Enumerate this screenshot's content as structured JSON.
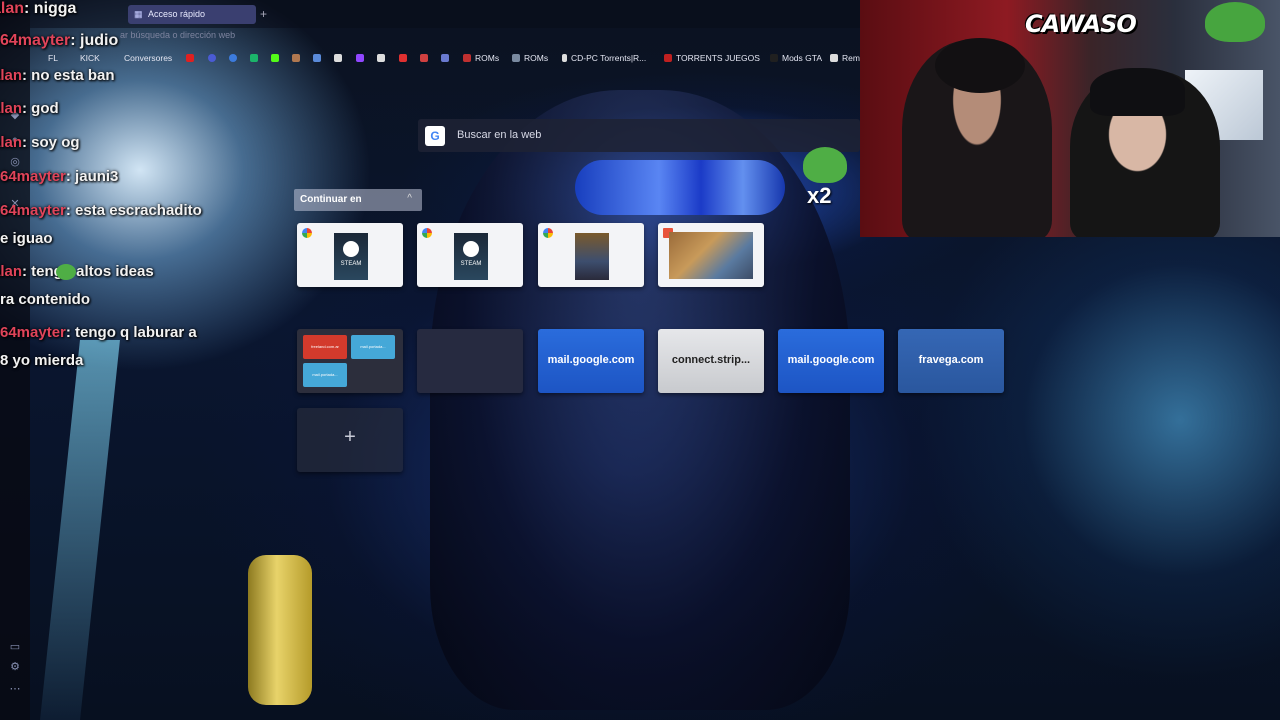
{
  "browser": {
    "tab_title": "Acceso rápido",
    "new_tab_symbol": "+",
    "address_placeholder": "ar búsqueda o dirección web",
    "bookmarks": [
      {
        "label": "FL",
        "color": "#c9c9c9"
      },
      {
        "label": "KICK",
        "color": "#c9c9c9"
      },
      {
        "label": "Conversores",
        "color": "#c9c9c9"
      },
      {
        "label": "",
        "color": "#e02020"
      },
      {
        "label": "",
        "color": "#4a5bd4"
      },
      {
        "label": "",
        "color": "#3c7bdd"
      },
      {
        "label": "",
        "color": "#1bb46a"
      },
      {
        "label": "",
        "color": "#53fc18"
      },
      {
        "label": "",
        "color": "#b07850"
      },
      {
        "label": "",
        "color": "#5a8ad9"
      },
      {
        "label": "",
        "color": "#dddddd"
      },
      {
        "label": "",
        "color": "#9147ff"
      },
      {
        "label": "",
        "color": "#dddddd"
      },
      {
        "label": "",
        "color": "#e03030"
      },
      {
        "label": "",
        "color": "#d04040"
      },
      {
        "label": "",
        "color": "#6a7ad0"
      },
      {
        "label": "ROMs",
        "color": "#c03030"
      },
      {
        "label": "ROMs",
        "color": "#7a8aa0"
      },
      {
        "label": "CD-PC Torrents|R...",
        "color": "#dddddd"
      },
      {
        "label": "TORRENTS JUEGOS",
        "color": "#c02020"
      },
      {
        "label": "Mods GTA",
        "color": "#202020"
      },
      {
        "label": "Rem",
        "color": "#dddddd"
      }
    ]
  },
  "chat": [
    {
      "user": "alan",
      "message": ": nigga"
    },
    {
      "user": "64mayter",
      "message": ": judio"
    },
    {
      "user": "alan",
      "message": ": no esta ban"
    },
    {
      "user": "alan",
      "message": ": god"
    },
    {
      "user": "alan",
      "message": ": soy og"
    },
    {
      "user": "64mayter",
      "message": ": jauni3"
    },
    {
      "user": "64mayter",
      "message": ": esta escrachadito"
    },
    {
      "user": "",
      "message": "e iguao"
    },
    {
      "user": "alan",
      "message": ":     tengo altos ideas"
    },
    {
      "user": "",
      "message": "ra contenido"
    },
    {
      "user": "64mayter",
      "message": ": tengo q laburar a"
    },
    {
      "user": "",
      "message": " 8 yo mierda"
    }
  ],
  "speed_dial": {
    "search_placeholder": "Buscar en la web",
    "search_engine_icon": "G",
    "continue_label": "Continuar en",
    "continue_caret": "^",
    "tiles_row1": [
      {
        "kind": "steam",
        "thumb_text": "STEAM"
      },
      {
        "kind": "steam",
        "thumb_text": "STEAM"
      },
      {
        "kind": "game"
      },
      {
        "kind": "game-wide"
      }
    ],
    "tiles_row2": [
      {
        "kind": "folder",
        "items": [
          "freeland.com.ar",
          "mail.portada...",
          "mail.portada..."
        ]
      },
      {
        "kind": "dark",
        "label": ""
      },
      {
        "kind": "blue",
        "label": "mail.google.com"
      },
      {
        "kind": "grey",
        "label": "connect.strip..."
      },
      {
        "kind": "blue",
        "label": "mail.google.com"
      },
      {
        "kind": "steel",
        "label": "fravega.com"
      }
    ],
    "add_symbol": "+"
  },
  "overlay": {
    "emote_multiplier": "x2",
    "cam_logo": "CAWASO"
  },
  "sidebar_icons": [
    "vivaldi-icon",
    "whatsapp-icon",
    "instagram-icon",
    "x-icon",
    "panel-icon",
    "settings-icon",
    "more-icon"
  ]
}
